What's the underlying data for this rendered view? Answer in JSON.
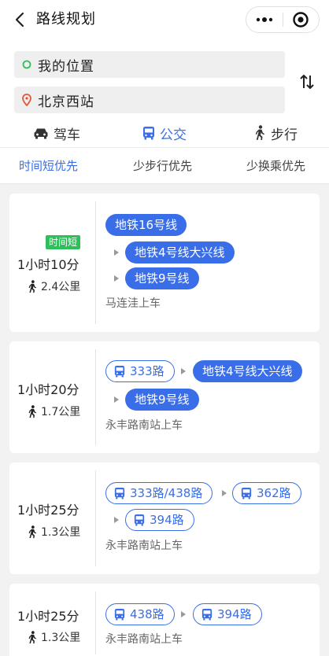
{
  "header": {
    "title": "路线规划"
  },
  "search": {
    "origin": "我的位置",
    "destination": "北京西站"
  },
  "modes": [
    {
      "label": "驾车",
      "icon": "car-icon"
    },
    {
      "label": "公交",
      "icon": "bus-icon",
      "active": true
    },
    {
      "label": "步行",
      "icon": "walk-icon"
    }
  ],
  "sorts": [
    "时间短优先",
    "少步行优先",
    "少换乘优先"
  ],
  "routes": [
    {
      "tag": "时间短",
      "duration": "1小时10分",
      "walk": "2.4公里",
      "segments": [
        "地铁16号线",
        "地铁4号线大兴线",
        "地铁9号线"
      ],
      "board": "马连洼上车"
    },
    {
      "duration": "1小时20分",
      "walk": "1.7公里",
      "segments": [
        "333路",
        "地铁4号线大兴线",
        "地铁9号线"
      ],
      "board": "永丰路南站上车"
    },
    {
      "duration": "1小时25分",
      "walk": "1.3公里",
      "segments": [
        "333路/438路",
        "362路",
        "394路"
      ],
      "board": "永丰路南站上车"
    },
    {
      "duration": "1小时25分",
      "walk": "1.3公里",
      "segments": [
        "438路",
        "394路"
      ],
      "board": "永丰路南站上车"
    }
  ],
  "colors": {
    "accent": "#3a6ee8",
    "tag": "#2fbf5a",
    "origin": "#2fbf5a",
    "destination": "#e2573b"
  }
}
